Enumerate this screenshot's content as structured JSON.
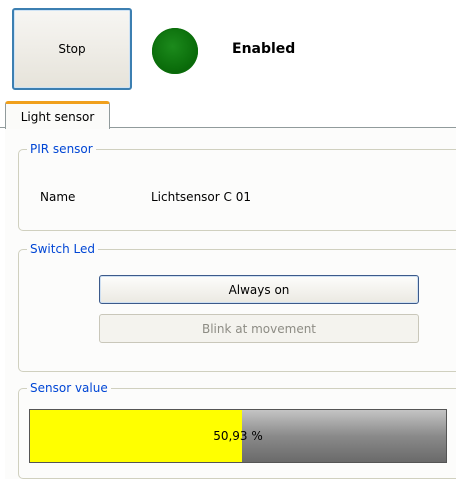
{
  "toolbar": {
    "stop_label": "Stop",
    "status_text": "Enabled",
    "status_led_color": "#0b6e0b"
  },
  "tabs": [
    {
      "label": "Light sensor",
      "active": true
    }
  ],
  "pir_sensor": {
    "title": "PIR sensor",
    "name_label": "Name",
    "name_value": "Lichtsensor C 01"
  },
  "switch_led": {
    "title": "Switch Led",
    "always_on_label": "Always on",
    "blink_label": "Blink at movement"
  },
  "sensor_value": {
    "title": "Sensor value",
    "percent_text": "50,93 %",
    "fraction": 0.5093,
    "fill_color": "#ffff00"
  }
}
